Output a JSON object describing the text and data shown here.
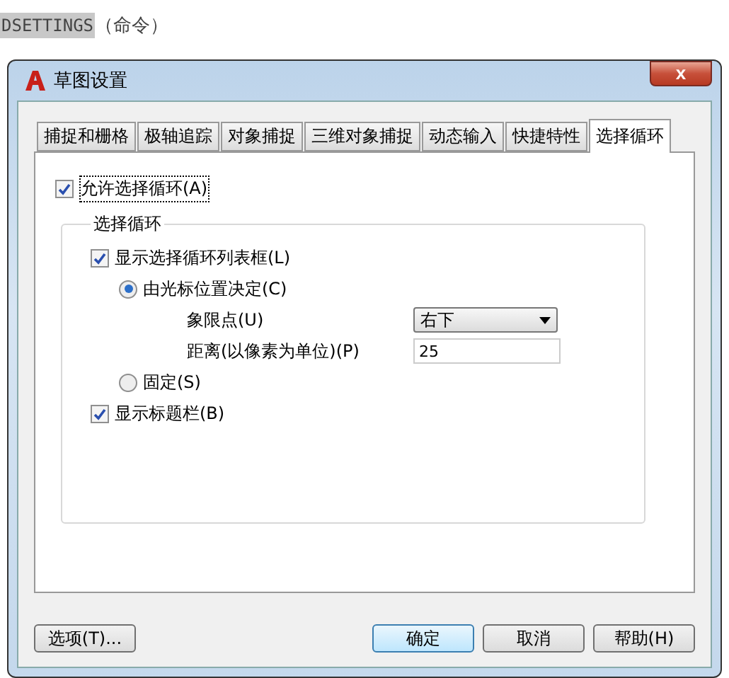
{
  "caption": {
    "command": "DSETTINGS",
    "suffix": "（命令）"
  },
  "window": {
    "title": "草图设置",
    "close": "x"
  },
  "tabs": [
    {
      "label": "捕捉和栅格",
      "selected": false
    },
    {
      "label": "极轴追踪",
      "selected": false
    },
    {
      "label": "对象捕捉",
      "selected": false
    },
    {
      "label": "三维对象捕捉",
      "selected": false
    },
    {
      "label": "动态输入",
      "selected": false
    },
    {
      "label": "快捷特性",
      "selected": false
    },
    {
      "label": "选择循环",
      "selected": true
    }
  ],
  "allow_cycling": {
    "label": "允许选择循环(A)",
    "checked": true
  },
  "group": {
    "title": "选择循环",
    "show_list": {
      "label": "显示选择循环列表框(L)",
      "checked": true
    },
    "position_options": [
      {
        "label": "由光标位置决定(C)",
        "selected": true
      },
      {
        "label": "固定(S)",
        "selected": false
      }
    ],
    "quadrant": {
      "label": "象限点(U)",
      "value": "右下"
    },
    "distance": {
      "label": "距离(以像素为单位)(P)",
      "value": "25"
    },
    "show_title": {
      "label": "显示标题栏(B)",
      "checked": true
    }
  },
  "buttons": [
    {
      "label": "选项(T)...",
      "kind": "plain"
    },
    {
      "label": "确定",
      "kind": "default"
    },
    {
      "label": "取消",
      "kind": "plain"
    },
    {
      "label": "帮助(H)",
      "kind": "plain"
    }
  ]
}
